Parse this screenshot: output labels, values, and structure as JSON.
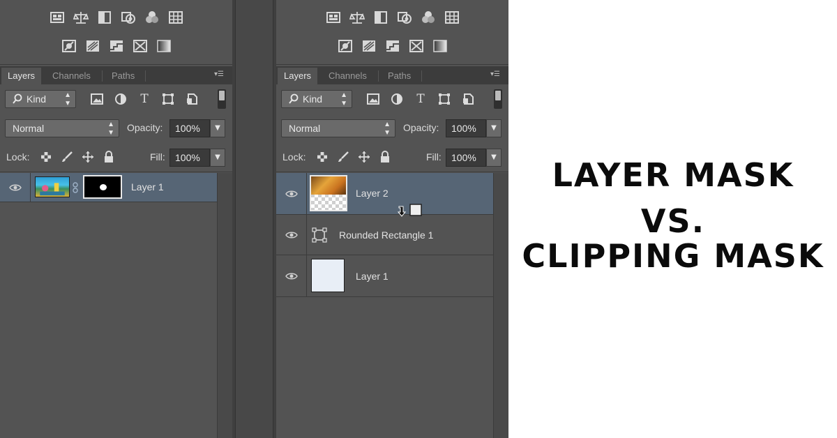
{
  "left_panel": {
    "tabs": [
      "Layers",
      "Channels",
      "Paths"
    ],
    "kind_label": "Kind",
    "blend_mode": "Normal",
    "opacity_label": "Opacity:",
    "opacity_value": "100%",
    "lock_label": "Lock:",
    "fill_label": "Fill:",
    "fill_value": "100%",
    "layers": [
      {
        "name": "Layer 1",
        "selected": true,
        "has_mask": true
      }
    ]
  },
  "right_panel": {
    "tabs": [
      "Layers",
      "Channels",
      "Paths"
    ],
    "kind_label": "Kind",
    "blend_mode": "Normal",
    "opacity_label": "Opacity:",
    "opacity_value": "100%",
    "lock_label": "Lock:",
    "fill_label": "Fill:",
    "fill_value": "100%",
    "layers": [
      {
        "name": "Layer 2",
        "selected": true,
        "clipping_cursor": true
      },
      {
        "name": "Rounded Rectangle 1",
        "selected": false
      },
      {
        "name": "Layer 1",
        "selected": false
      }
    ]
  },
  "title": {
    "line1": "LAYER MASK",
    "line2": "VS.",
    "line3": "CLIPPING MASK"
  },
  "colors": {
    "panel_bg": "#535353",
    "selected_row": "#566575",
    "tab_bar": "#3c3c3c"
  }
}
